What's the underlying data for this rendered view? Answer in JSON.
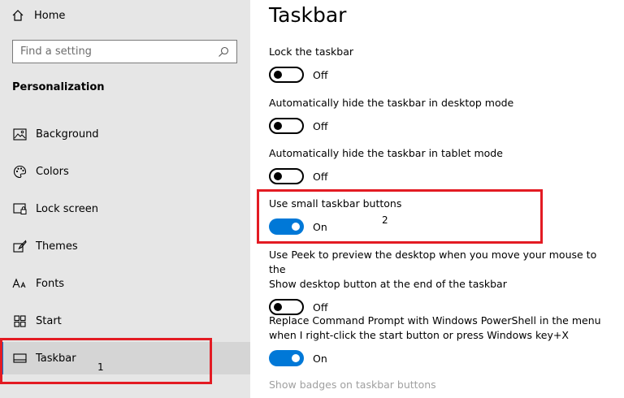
{
  "sidebar": {
    "home_label": "Home",
    "search_placeholder": "Find a setting",
    "section_title": "Personalization",
    "items": [
      {
        "label": "Background",
        "icon": "image-icon"
      },
      {
        "label": "Colors",
        "icon": "palette-icon"
      },
      {
        "label": "Lock screen",
        "icon": "lock-screen-icon"
      },
      {
        "label": "Themes",
        "icon": "brush-icon"
      },
      {
        "label": "Fonts",
        "icon": "font-icon"
      },
      {
        "label": "Start",
        "icon": "start-icon"
      },
      {
        "label": "Taskbar",
        "icon": "taskbar-icon",
        "selected": true
      }
    ]
  },
  "main": {
    "title": "Taskbar",
    "settings": [
      {
        "label": "Lock the taskbar",
        "state": "Off"
      },
      {
        "label": "Automatically hide the taskbar in desktop mode",
        "state": "Off"
      },
      {
        "label": "Automatically hide the taskbar in tablet mode",
        "state": "Off"
      },
      {
        "label": "Use small taskbar buttons",
        "state": "On"
      },
      {
        "label_line1": "Use Peek to preview the desktop when you move your mouse to the",
        "label_line2": "Show desktop button at the end of the taskbar",
        "state": "Off"
      },
      {
        "label_line1": "Replace Command Prompt with Windows PowerShell in the menu",
        "label_line2": "when I right-click the start button or press Windows key+X",
        "state": "On"
      }
    ],
    "faded_label": "Show badges on taskbar buttons"
  },
  "annotations": {
    "marker_1": "1",
    "marker_2": "2",
    "highlight_color": "#e31b23"
  },
  "colors": {
    "accent": "#0078d7",
    "sidebar_bg": "#e6e6e6"
  }
}
